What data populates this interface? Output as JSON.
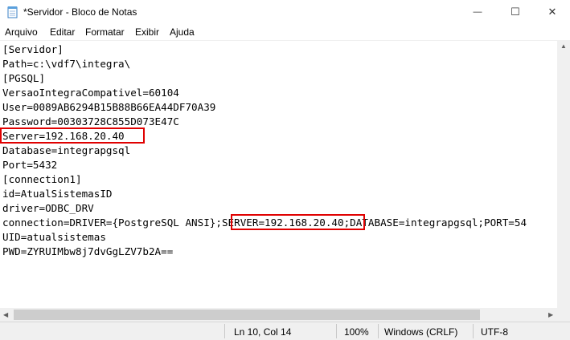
{
  "window": {
    "title": "*Servidor - Bloco de Notas",
    "minimize": "—",
    "maximize": "☐",
    "close": "✕"
  },
  "menu": [
    "Arquivo",
    "Editar",
    "Formatar",
    "Exibir",
    "Ajuda"
  ],
  "lines": [
    "[Servidor]",
    "Path=c:\\vdf7\\integra\\",
    "[PGSQL]",
    "VersaoIntegraCompativel=60104",
    "User=0089AB6294B15B88B66EA44DF70A39",
    "Password=00303728C855D073E47C",
    "Server=192.168.20.40",
    "Database=integrapgsql",
    "Port=5432",
    "[connection1]",
    "id=AtualSistemasID",
    "driver=ODBC_DRV",
    "connection=DRIVER={PostgreSQL ANSI};SERVER=192.168.20.40;DATABASE=integrapgsql;PORT=54",
    "UID=atualsistemas",
    "PWD=ZYRUIMbw8j7dvGgLZV7b2A=="
  ],
  "status": {
    "position": "Ln 10, Col 14",
    "zoom": "100%",
    "line_ending": "Windows (CRLF)",
    "encoding": "UTF-8"
  },
  "accent_colors": {
    "highlight": "#e00000"
  }
}
